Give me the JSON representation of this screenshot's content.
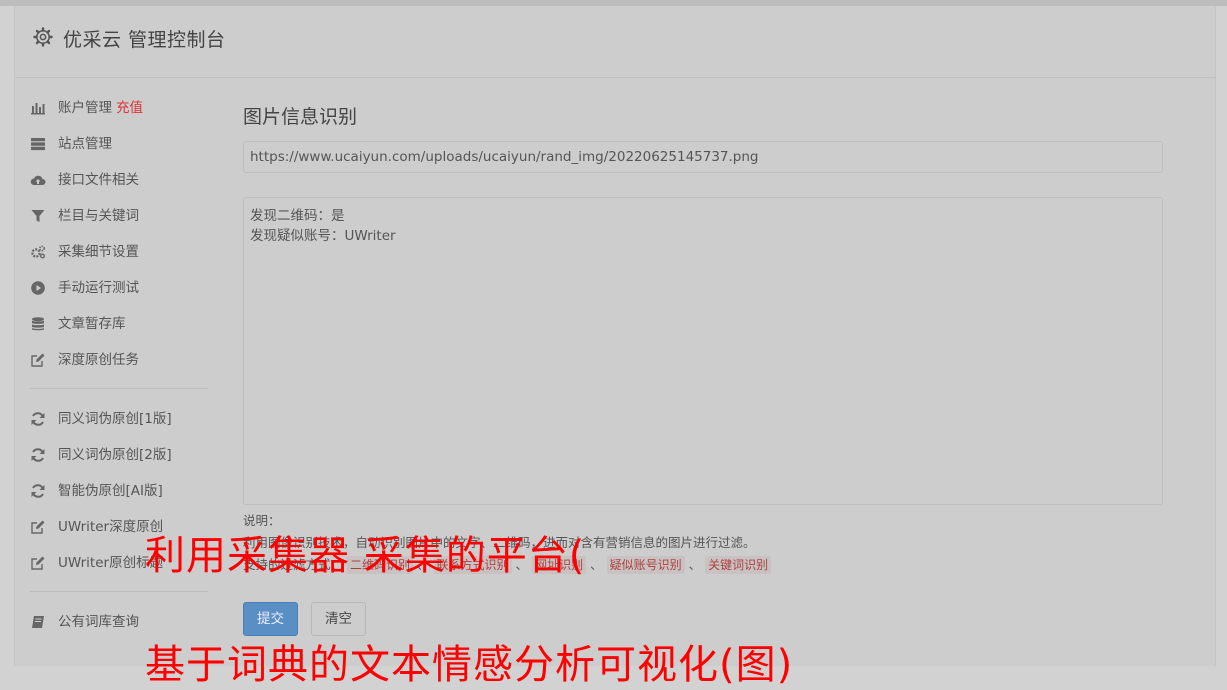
{
  "header": {
    "title": "优采云 管理控制台"
  },
  "sidebar": {
    "groups": [
      [
        {
          "label": "账户管理",
          "extra": "充值",
          "icon": "bar-chart-icon"
        },
        {
          "label": "站点管理",
          "icon": "server-icon"
        },
        {
          "label": "接口文件相关",
          "icon": "cloud-upload-icon"
        },
        {
          "label": "栏目与关键词",
          "icon": "filter-icon"
        },
        {
          "label": "采集细节设置",
          "icon": "cogs-icon"
        },
        {
          "label": "手动运行测试",
          "icon": "play-circle-icon"
        },
        {
          "label": "文章暂存库",
          "icon": "database-icon"
        },
        {
          "label": "深度原创任务",
          "icon": "edit-icon"
        }
      ],
      [
        {
          "label": "同义词伪原创[1版]",
          "icon": "refresh-icon"
        },
        {
          "label": "同义词伪原创[2版]",
          "icon": "refresh-icon"
        },
        {
          "label": "智能伪原创[AI版]",
          "icon": "refresh-icon"
        },
        {
          "label": "UWriter深度原创",
          "icon": "edit-icon"
        },
        {
          "label": "UWriter原创标题",
          "icon": "edit-icon"
        }
      ],
      [
        {
          "label": "公有词库查询",
          "icon": "book-icon"
        }
      ]
    ]
  },
  "main": {
    "heading": "图片信息识别",
    "url_value": "https://www.ucaiyun.com/uploads/ucaiyun/rand_img/20220625145737.png",
    "result_text": "发现二维码：是\n发现疑似账号：UWriter",
    "desc_label": "说明：",
    "desc_line": "利用图像识别技术，自动识别图片中的文字、二维码，进而对含有营销信息的图片进行过滤。",
    "filter_label": "支持的过滤方式：",
    "filters": [
      "二维码识别",
      "联系方式识别",
      "网址识别",
      "疑似账号识别",
      "关键词识别"
    ],
    "filter_sep": "、",
    "submit_label": "提交",
    "clear_label": "清空"
  },
  "overlay": {
    "line1": "利用采集器 采集的平台(",
    "line2": "基于词典的文本情感分析可视化(图)"
  },
  "colors": {
    "accent": "#5a8fc6",
    "recharge": "#dd3333",
    "overlay": "#ff0000"
  }
}
